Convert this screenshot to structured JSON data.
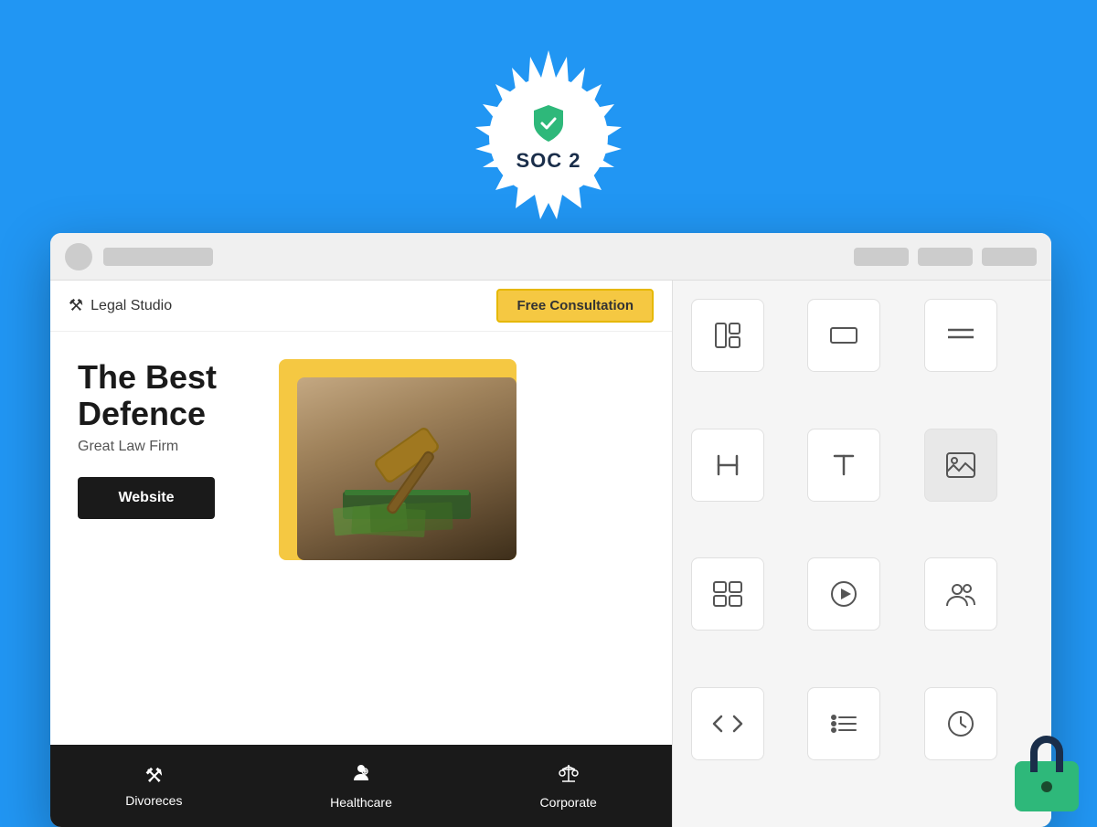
{
  "background_color": "#2196F3",
  "soc2": {
    "label": "SOC 2",
    "badge_color": "#2eb87a"
  },
  "browser": {
    "chrome": {
      "dot_color": "#cccccc",
      "url_bar_placeholder": ""
    }
  },
  "website": {
    "nav": {
      "logo_icon": "⚖",
      "logo_text": "Legal Studio",
      "cta_label": "Free Consultation"
    },
    "hero": {
      "title_line1": "The Best",
      "title_line2": "Defence",
      "subtitle": "Great Law Firm",
      "cta_label": "Website"
    },
    "bottom_nav": {
      "items": [
        {
          "label": "Divoreces",
          "icon": "⚖"
        },
        {
          "label": "Healthcare",
          "icon": "👤"
        },
        {
          "label": "Corporate",
          "icon": "⚖"
        }
      ]
    }
  },
  "toolbar": {
    "buttons": [
      {
        "icon": "⊞",
        "label": "layout-icon"
      },
      {
        "icon": "▭",
        "label": "rectangle-icon"
      },
      {
        "icon": "≡",
        "label": "menu-icon"
      },
      {
        "icon": "H",
        "label": "heading-icon"
      },
      {
        "icon": "T",
        "label": "text-icon"
      },
      {
        "icon": "🖼",
        "label": "image-icon"
      },
      {
        "icon": "⊡",
        "label": "gallery-icon"
      },
      {
        "icon": "▶",
        "label": "video-icon"
      },
      {
        "icon": "👤",
        "label": "team-icon"
      },
      {
        "icon": "</>",
        "label": "code-icon"
      },
      {
        "icon": "☰",
        "label": "list-icon"
      },
      {
        "icon": "🕐",
        "label": "clock-icon"
      }
    ]
  },
  "lock": {
    "color": "#2eb87a"
  }
}
